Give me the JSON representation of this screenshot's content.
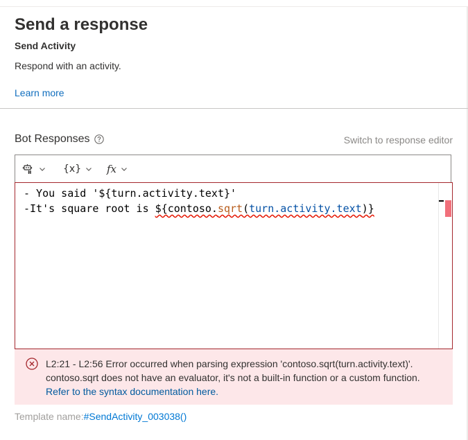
{
  "header": {
    "title": "Send a response",
    "subtitle": "Send Activity",
    "description": "Respond with an activity.",
    "learn_more": "Learn more"
  },
  "responses": {
    "label": "Bot Responses",
    "switch_editor": "Switch to response editor"
  },
  "toolbar": {
    "items": [
      {
        "icon": "bot-template-icon"
      },
      {
        "label": "{x}",
        "icon": "variable-icon"
      },
      {
        "label": "fx",
        "icon": "function-icon"
      }
    ]
  },
  "editor": {
    "line1": "- You said '${turn.activity.text}'",
    "line2_prefix": "-It's square root is ",
    "line2_dollar": "$",
    "line2_open": "{contoso.",
    "line2_fn": "sqrt",
    "line2_paren_open": "(",
    "line2_arg": "turn.activity.text",
    "line2_close": ")}"
  },
  "error": {
    "message": "L2:21 - L2:56 Error occurred when parsing expression 'contoso.sqrt(turn.activity.text)'. contoso.sqrt does not have an evaluator, it's not a built-in function or a custom function. ",
    "link": "Refer to the syntax documentation here.",
    "colors": {
      "background": "#fde7e9",
      "icon": "#a4262c"
    }
  },
  "template": {
    "label": "Template name:",
    "name": "#SendActivity_003038()"
  },
  "colors": {
    "link": "#0078d4",
    "error_border": "#a4262c"
  }
}
